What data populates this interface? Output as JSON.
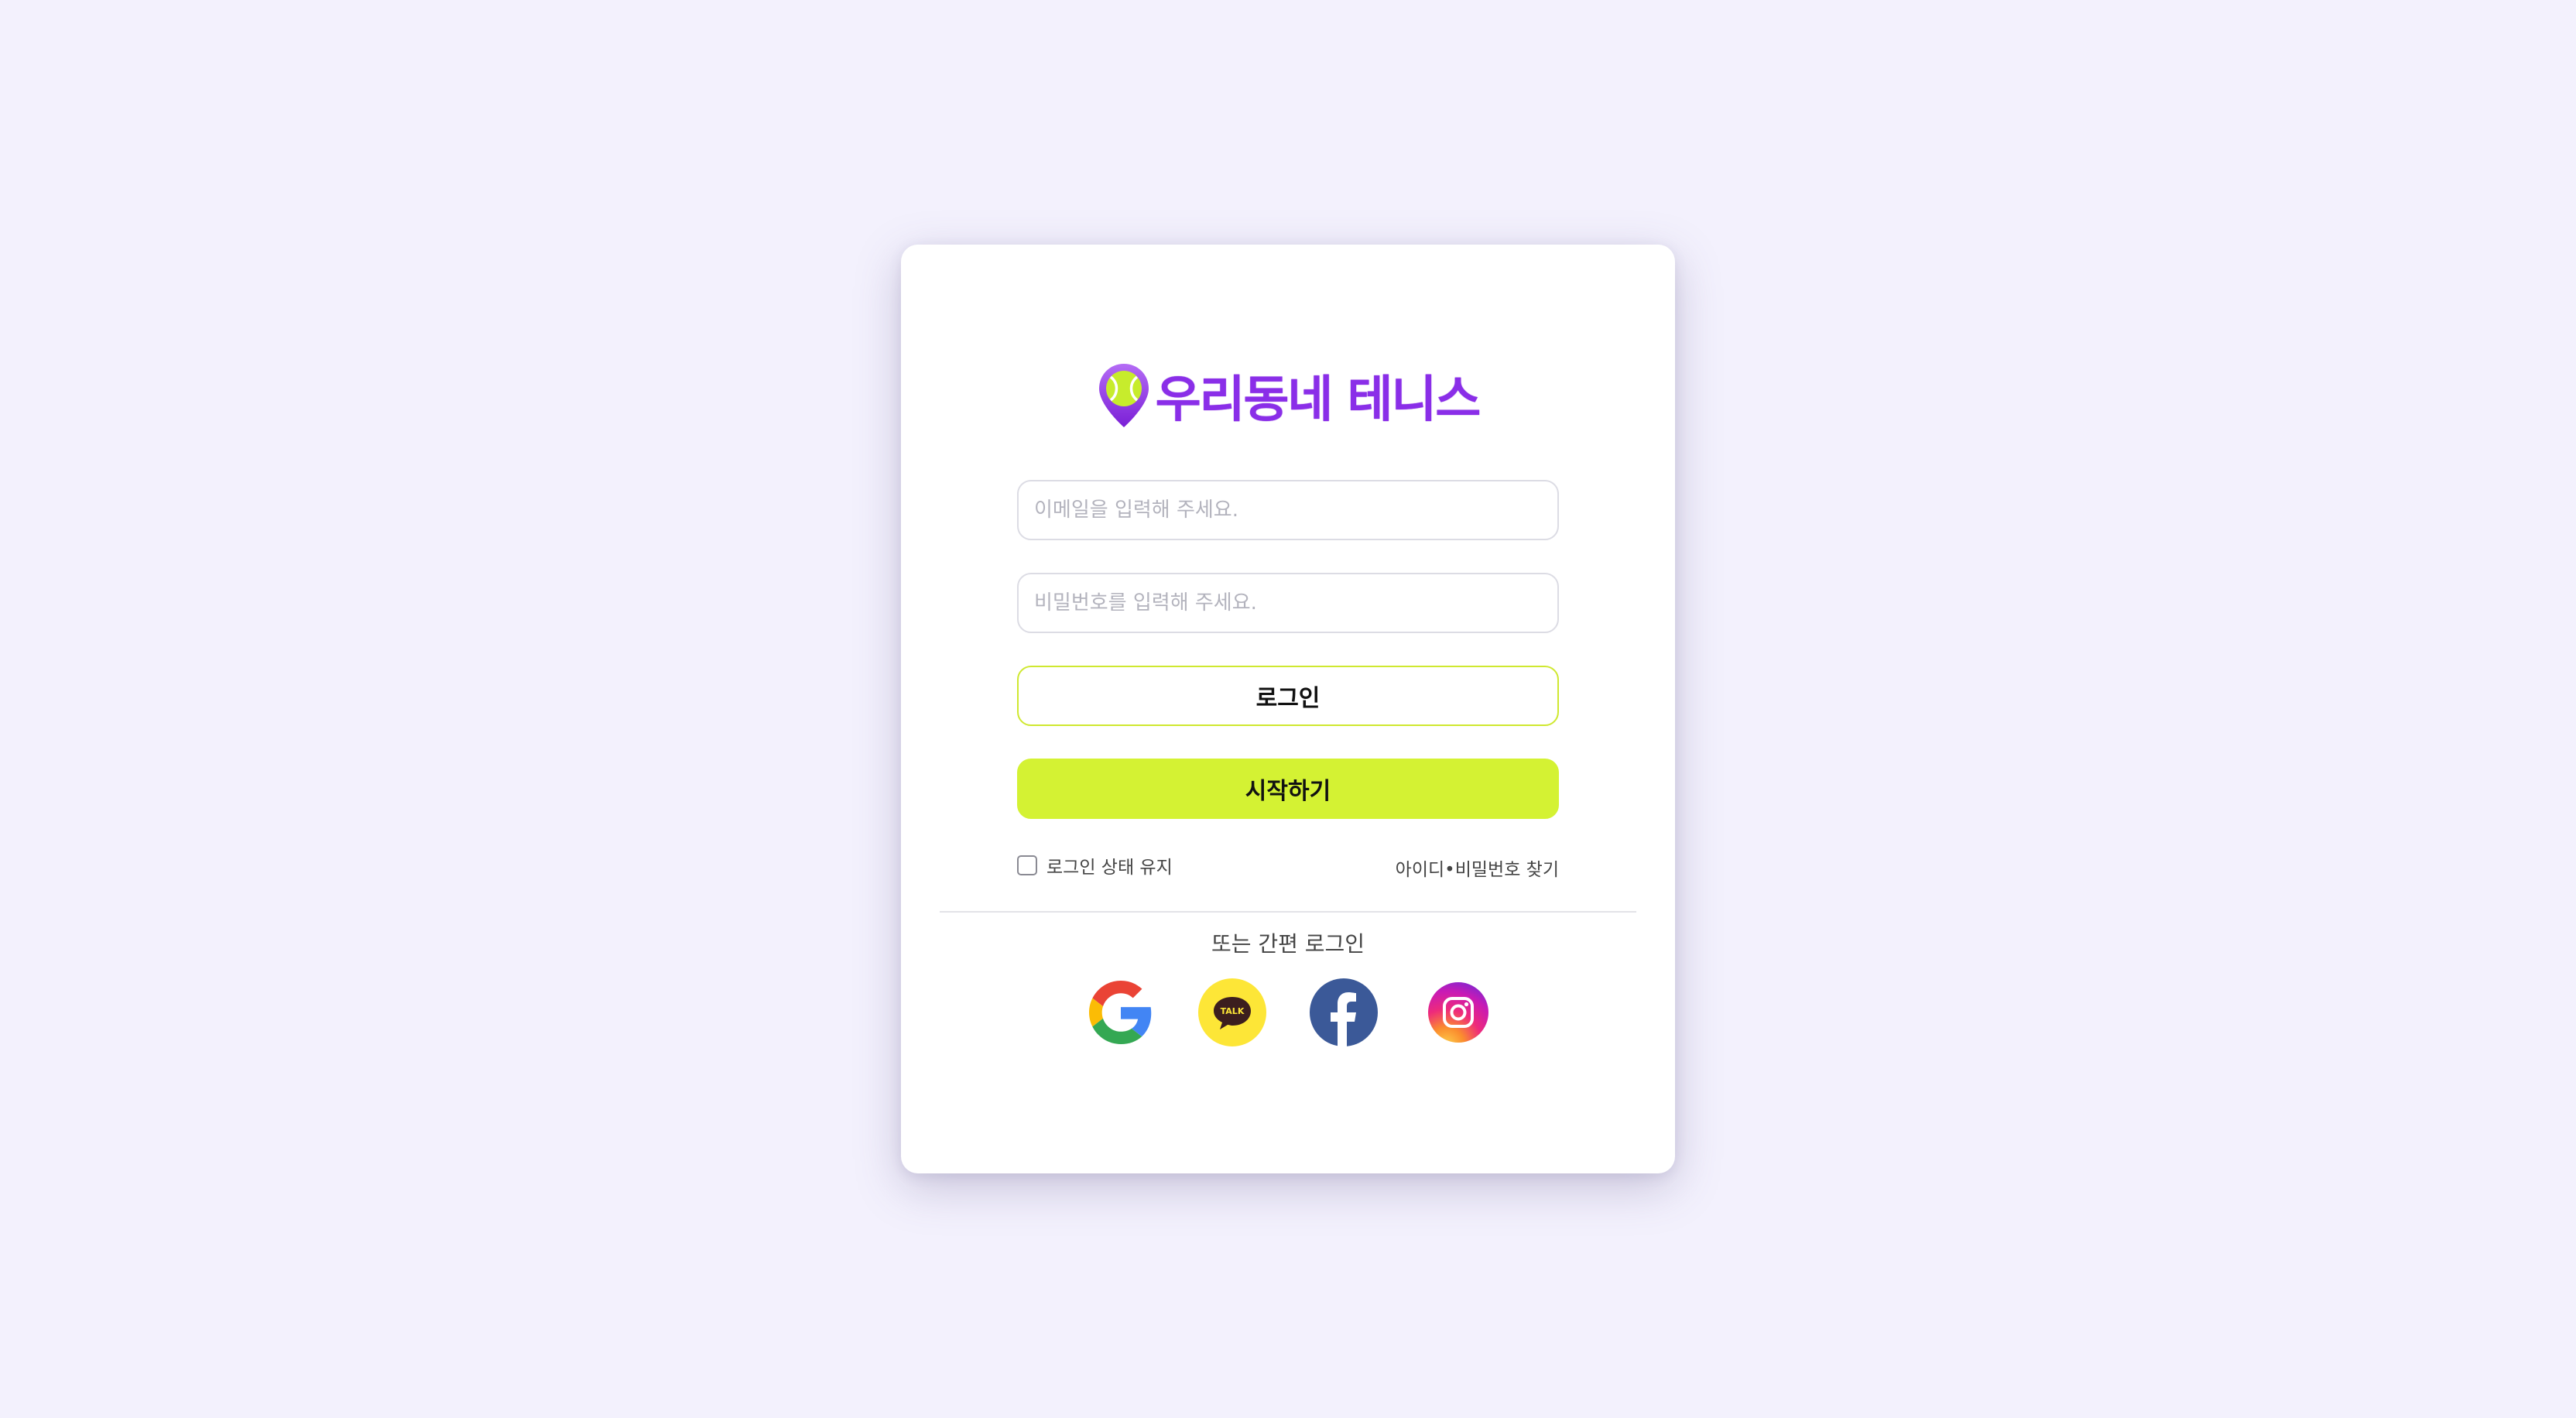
{
  "brand": {
    "name": "우리동네 테니스",
    "primary_color": "#8a2ee8",
    "accent_color": "#d4f233",
    "logo_icon": "tennis-ball-location-pin-icon"
  },
  "form": {
    "email_placeholder": "이메일을 입력해 주세요.",
    "password_placeholder": "비밀번호를 입력해 주세요.",
    "login_label": "로그인",
    "start_label": "시작하기",
    "remember_label": "로그인 상태 유지",
    "remember_checked": false,
    "find_account_label": "아이디•비밀번호 찾기"
  },
  "social": {
    "title": "또는 간편 로그인",
    "providers": [
      {
        "name": "Google",
        "icon": "google-icon"
      },
      {
        "name": "Kakao",
        "icon": "kakao-talk-icon",
        "badge": "TALK"
      },
      {
        "name": "Facebook",
        "icon": "facebook-icon"
      },
      {
        "name": "Instagram",
        "icon": "instagram-icon"
      }
    ]
  }
}
